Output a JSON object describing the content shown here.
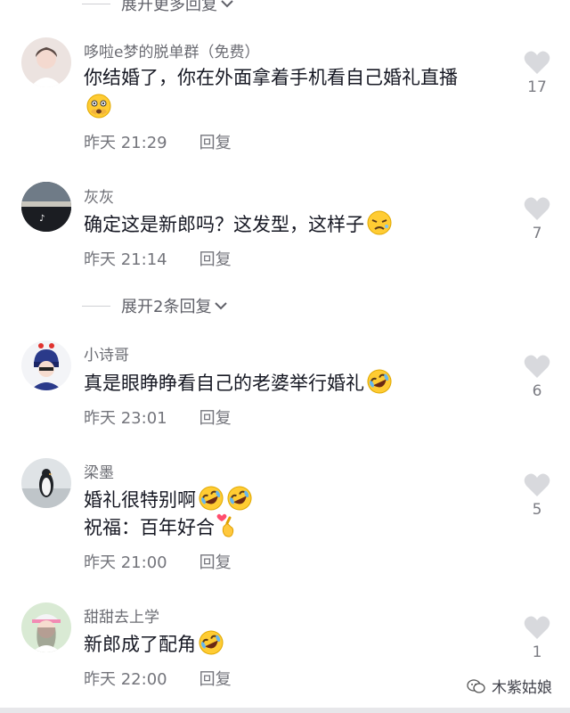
{
  "top_expand": {
    "label": "展开更多回复"
  },
  "mid_expand": {
    "label": "展开2条回复"
  },
  "reply_label": "回复",
  "comments": [
    {
      "username": "哆啦e梦的脱单群（免费）",
      "lines": [
        "你结婚了，你在外面拿着手机看自己婚礼直播"
      ],
      "emoji": [
        "fearful-face-icon"
      ],
      "time": "昨天 21:29",
      "likes": "17"
    },
    {
      "username": "灰灰",
      "lines": [
        "确定这是新郎吗？这发型，这样子"
      ],
      "emoji": [
        "weary-face-icon"
      ],
      "time": "昨天 21:14",
      "likes": "7"
    },
    {
      "username": "小诗哥",
      "lines": [
        "真是眼睁睁看自己的老婆举行婚礼"
      ],
      "emoji": [
        "rofl-face-icon"
      ],
      "time": "昨天 23:01",
      "likes": "6"
    },
    {
      "username": "梁墨",
      "lines": [
        "婚礼很特别啊",
        "祝福：百年好合"
      ],
      "emoji": [
        "rofl-face-icon",
        "rofl-face-icon",
        "finger-heart-icon"
      ],
      "time": "昨天 21:00",
      "likes": "5"
    },
    {
      "username": "甜甜去上学",
      "lines": [
        "新郎成了配角"
      ],
      "emoji": [
        "rofl-face-icon"
      ],
      "time": "昨天 22:00",
      "likes": "1"
    }
  ],
  "watermark": {
    "text": "木紫姑娘",
    "icon": "wechat-icon"
  },
  "colors": {
    "text": "#161823",
    "secondary": "#74757c",
    "like_icon": "#d8d9dd"
  }
}
